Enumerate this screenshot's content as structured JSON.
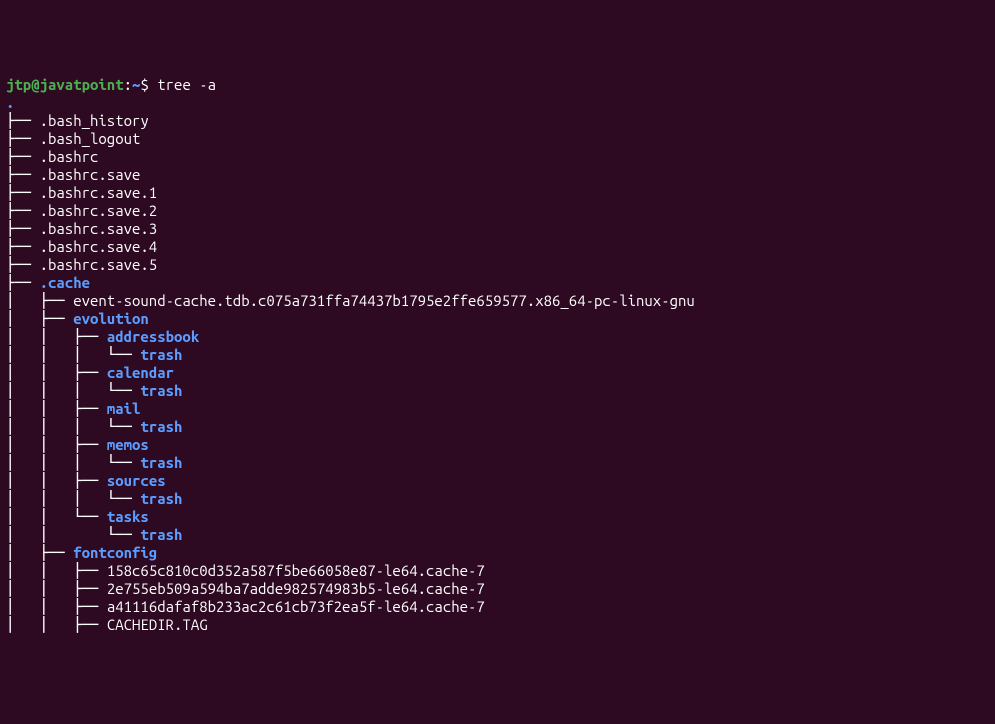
{
  "prompt": {
    "user": "jtp",
    "at": "@",
    "host": "javatpoint",
    "colon": ":",
    "path": "~",
    "dollar": "$",
    "command": "tree -a"
  },
  "root": ".",
  "lines": [
    {
      "prefix": "├── ",
      "name": ".bash_history",
      "type": "file"
    },
    {
      "prefix": "├── ",
      "name": ".bash_logout",
      "type": "file"
    },
    {
      "prefix": "├── ",
      "name": ".bashrc",
      "type": "file"
    },
    {
      "prefix": "├── ",
      "name": ".bashrc.save",
      "type": "file"
    },
    {
      "prefix": "├── ",
      "name": ".bashrc.save.1",
      "type": "file"
    },
    {
      "prefix": "├── ",
      "name": ".bashrc.save.2",
      "type": "file"
    },
    {
      "prefix": "├── ",
      "name": ".bashrc.save.3",
      "type": "file"
    },
    {
      "prefix": "├── ",
      "name": ".bashrc.save.4",
      "type": "file"
    },
    {
      "prefix": "├── ",
      "name": ".bashrc.save.5",
      "type": "file"
    },
    {
      "prefix": "├── ",
      "name": ".cache",
      "type": "dir"
    },
    {
      "prefix": "│   ├── ",
      "name": "event-sound-cache.tdb.c075a731ffa74437b1795e2ffe659577.x86_64-pc-linux-gnu",
      "type": "file"
    },
    {
      "prefix": "│   ├── ",
      "name": "evolution",
      "type": "dir"
    },
    {
      "prefix": "│   │   ├── ",
      "name": "addressbook",
      "type": "dir"
    },
    {
      "prefix": "│   │   │   └── ",
      "name": "trash",
      "type": "dir"
    },
    {
      "prefix": "│   │   ├── ",
      "name": "calendar",
      "type": "dir"
    },
    {
      "prefix": "│   │   │   └── ",
      "name": "trash",
      "type": "dir"
    },
    {
      "prefix": "│   │   ├── ",
      "name": "mail",
      "type": "dir"
    },
    {
      "prefix": "│   │   │   └── ",
      "name": "trash",
      "type": "dir"
    },
    {
      "prefix": "│   │   ├── ",
      "name": "memos",
      "type": "dir"
    },
    {
      "prefix": "│   │   │   └── ",
      "name": "trash",
      "type": "dir"
    },
    {
      "prefix": "│   │   ├── ",
      "name": "sources",
      "type": "dir"
    },
    {
      "prefix": "│   │   │   └── ",
      "name": "trash",
      "type": "dir"
    },
    {
      "prefix": "│   │   └── ",
      "name": "tasks",
      "type": "dir"
    },
    {
      "prefix": "│   │       └── ",
      "name": "trash",
      "type": "dir"
    },
    {
      "prefix": "│   ├── ",
      "name": "fontconfig",
      "type": "dir"
    },
    {
      "prefix": "│   │   ├── ",
      "name": "158c65c810c0d352a587f5be66058e87-le64.cache-7",
      "type": "file"
    },
    {
      "prefix": "│   │   ├── ",
      "name": "2e755eb509a594ba7adde982574983b5-le64.cache-7",
      "type": "file"
    },
    {
      "prefix": "│   │   ├── ",
      "name": "a41116dafaf8b233ac2c61cb73f2ea5f-le64.cache-7",
      "type": "file"
    },
    {
      "prefix": "│   │   ├── ",
      "name": "CACHEDIR.TAG",
      "type": "file"
    }
  ]
}
